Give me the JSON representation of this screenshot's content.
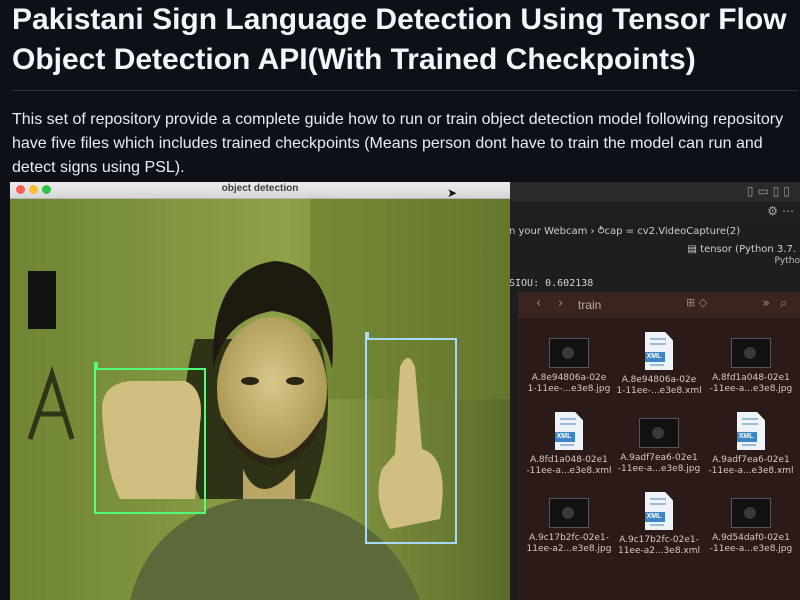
{
  "readme": {
    "title": "Pakistani Sign Language Detection Using Tensor Flow Object Detection API(With Trained Checkpoints)",
    "description": "This set of repository provide a complete guide how to run or train object detection model following repository have five files which includes trained checkpoints (Means person dont have to train the model can run and detect signs using PSL)."
  },
  "detection_window": {
    "title": "object detection",
    "traffic_lights": [
      "#ff5f57",
      "#febc2e",
      "#28c840"
    ],
    "boxes": [
      {
        "color": "#4dff7a"
      },
      {
        "color": "#a9d8ff"
      }
    ]
  },
  "ide": {
    "breadcrumb": "n your Webcam › ⥁cap = cv2.VideoCapture(2)",
    "kernel": "▤ tensor (Python 3.7.",
    "kernel_sub": "Pytho",
    "output": "SIOU: 0.602138",
    "icons": [
      "layout-icon",
      "gear-icon",
      "more-icon"
    ]
  },
  "finder": {
    "path": "train",
    "files": [
      {
        "name": "A.8e94806a-02e\n1-11ee-...e3e8.jpg",
        "type": "img"
      },
      {
        "name": "A.8e94806a-02e\n1-11ee-...e3e8.xml",
        "type": "xml"
      },
      {
        "name": "A.8fd1a048-02e1\n-11ee-a...e3e8.jpg",
        "type": "img"
      },
      {
        "name": "A.8fd1a048-02e1\n-11ee-a...e3e8.xml",
        "type": "xml"
      },
      {
        "name": "A.9adf7ea6-02e1\n-11ee-a...e3e8.jpg",
        "type": "img"
      },
      {
        "name": "A.9adf7ea6-02e1\n-11ee-a...e3e8.xml",
        "type": "xml"
      },
      {
        "name": "A.9c17b2fc-02e1-\n11ee-a2...e3e8.jpg",
        "type": "img"
      },
      {
        "name": "A.9c17b2fc-02e1-\n11ee-a2...3e8.xml",
        "type": "xml"
      },
      {
        "name": "A.9d54daf0-02e1\n-11ee-a...e3e8.jpg",
        "type": "img"
      }
    ]
  }
}
